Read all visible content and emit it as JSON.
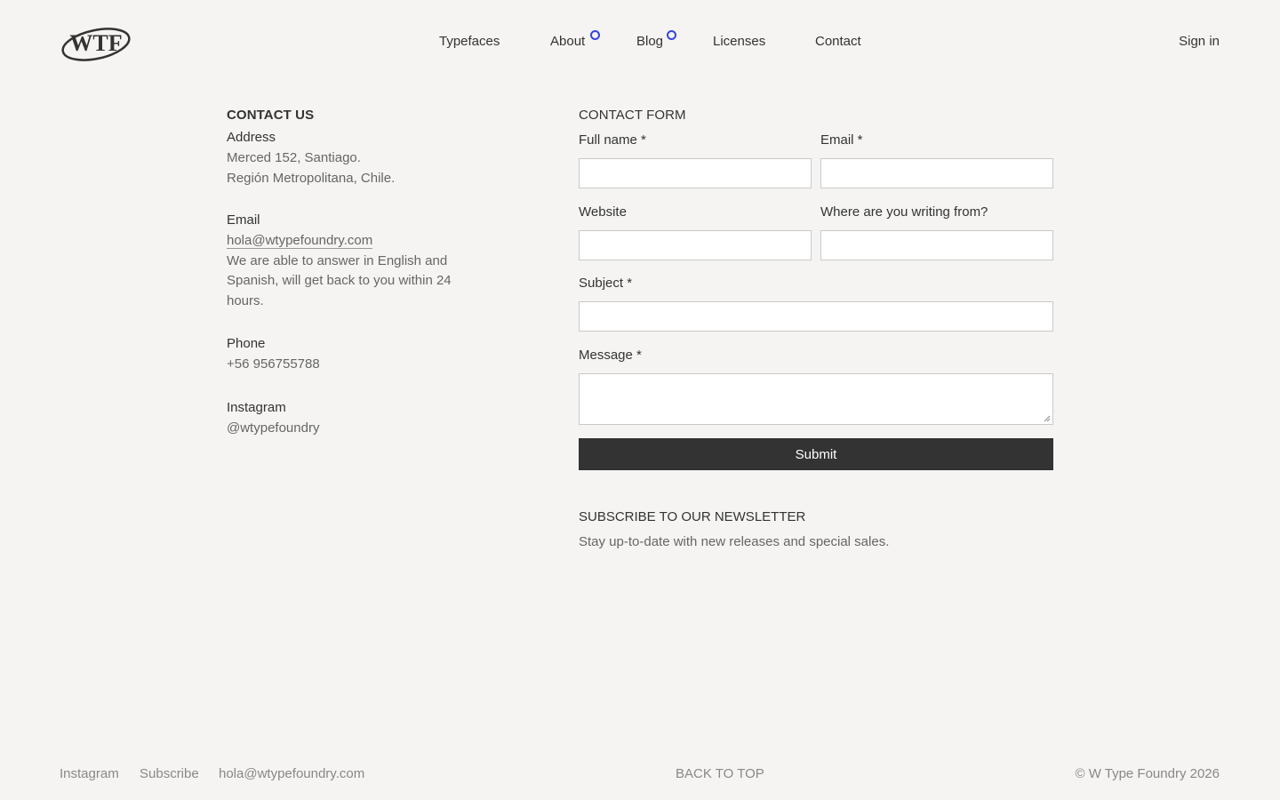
{
  "brand": {
    "logo_text": "WTF"
  },
  "nav": {
    "items": [
      {
        "label": "Typefaces"
      },
      {
        "label": "About",
        "has_dot": true
      },
      {
        "label": "Blog",
        "has_dot": true
      },
      {
        "label": "Licenses"
      },
      {
        "label": "Contact"
      }
    ],
    "sign_in": "Sign in"
  },
  "contact": {
    "title": "CONTACT US",
    "address_label": "Address",
    "address_line1": "Merced 152, Santiago.",
    "address_line2": "Región Metropolitana, Chile.",
    "email_label": "Email",
    "email": "hola@wtypefoundry.com",
    "email_note_line1": "We are able to answer in English and",
    "email_note_line2": "Spanish, will get back to you within 24",
    "email_note_line3": "hours.",
    "phone_label": "Phone",
    "phone": "+56 956755788",
    "instagram_label": "Instagram",
    "instagram": "@wtypefoundry"
  },
  "form": {
    "title": "CONTACT FORM",
    "full_name_label": "Full name *",
    "email_label": "Email *",
    "website_label": "Website",
    "location_label": "Where are you writing from?",
    "subject_label": "Subject *",
    "message_label": "Message *",
    "submit_label": "Submit"
  },
  "newsletter": {
    "title": "SUBSCRIBE TO OUR NEWSLETTER",
    "text": "Stay up-to-date with new releases and special sales."
  },
  "footer": {
    "instagram": "Instagram",
    "subscribe": "Subscribe",
    "email": "hola@wtypefoundry.com",
    "back_to_top": "BACK TO TOP",
    "copyright": "© W Type Foundry 2026"
  },
  "colors": {
    "accent_dot": "#3346e0",
    "button_bg": "#333333",
    "background": "#f5f4f2"
  }
}
